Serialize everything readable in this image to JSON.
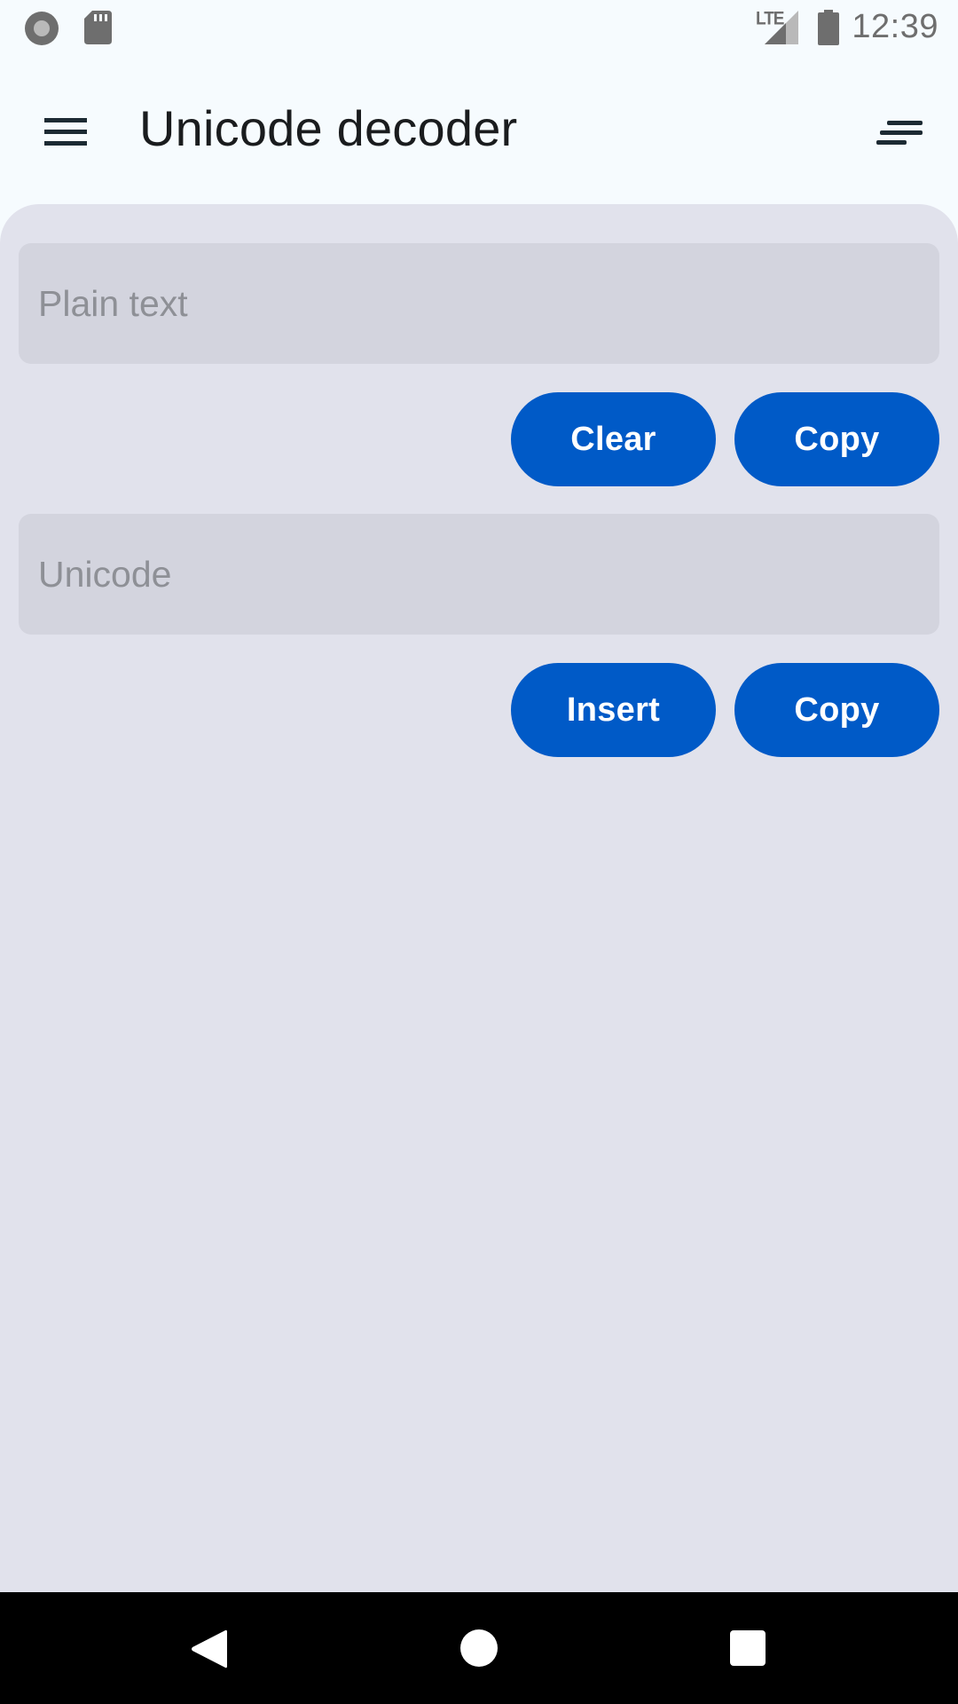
{
  "status_bar": {
    "time": "12:39",
    "network_label": "LTE",
    "icons": [
      "record-icon",
      "sd-card-icon",
      "signal-icon",
      "battery-icon"
    ]
  },
  "app_bar": {
    "title": "Unicode decoder",
    "menu_icon": "hamburger-menu-icon",
    "action_icon": "sort-icon"
  },
  "plain_text_section": {
    "placeholder": "Plain text",
    "value": "",
    "clear_label": "Clear",
    "copy_label": "Copy"
  },
  "unicode_section": {
    "placeholder": "Unicode",
    "value": "",
    "insert_label": "Insert",
    "copy_label": "Copy"
  },
  "nav_bar": {
    "icons": [
      "back-icon",
      "home-icon",
      "recents-icon"
    ]
  },
  "colors": {
    "accent": "#005ac7",
    "surface": "#e1e2ec",
    "field": "#d3d4de",
    "background": "#f6fbfe"
  }
}
